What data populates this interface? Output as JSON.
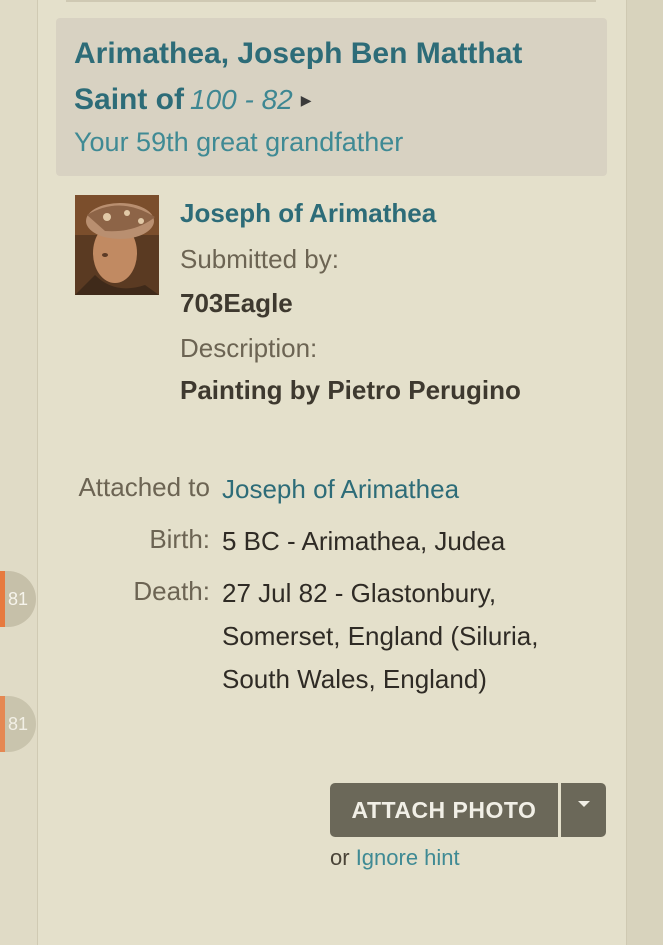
{
  "person": {
    "name": "Arimathea, Joseph Ben Matthat",
    "title": "Saint of",
    "dates": "100 - 82",
    "relationship": "Your 59th great grandfather"
  },
  "photo": {
    "title": "Joseph of Arimathea",
    "submitted_label": "Submitted by:",
    "submitter": "703Eagle",
    "description_label": "Description:",
    "description": "Painting by Pietro Perugino"
  },
  "attached": {
    "label": "Attached to",
    "name": "Joseph of Arimathea",
    "birth_label": "Birth:",
    "birth_value": "5 BC - Arimathea, Judea",
    "death_label": "Death:",
    "death_line1": "27 Jul 82 - Glastonbury,",
    "death_line2": "Somerset, England (Siluria,",
    "death_line3": "South Wales, England)"
  },
  "actions": {
    "attach_label": "ATTACH PHOTO",
    "or_text": "or",
    "ignore_label": "Ignore hint"
  },
  "side_tabs": [
    {
      "label": "81"
    },
    {
      "label": "81"
    }
  ],
  "colors": {
    "link": "#2d6c78",
    "button": "#6b6859",
    "accent": "#e77a3f"
  }
}
